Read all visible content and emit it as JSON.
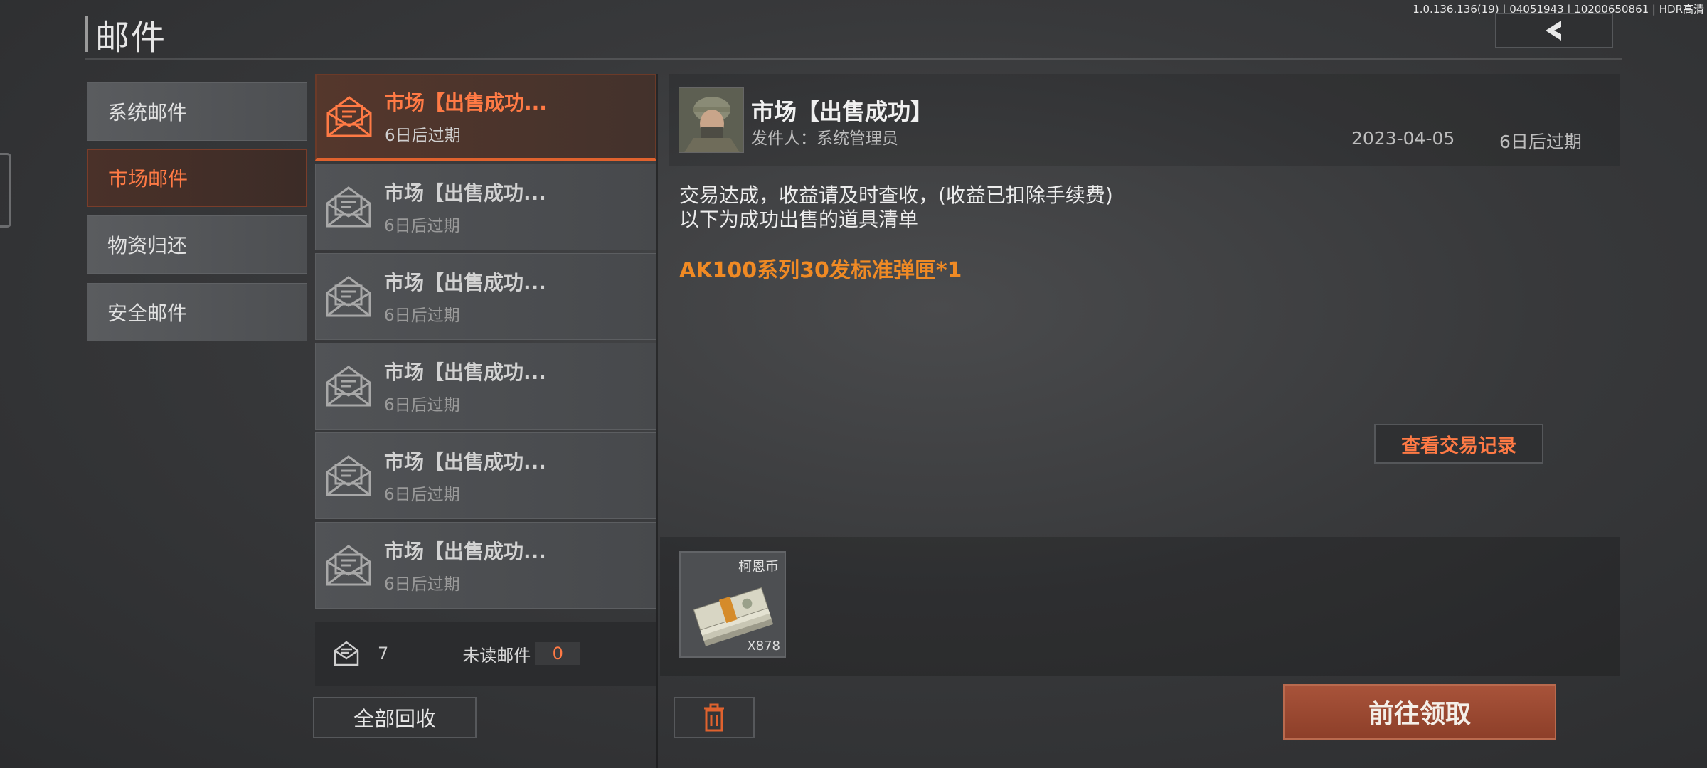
{
  "app": {
    "version": "1.0.136.136(19) | 04051943 | 10200650861 | HDR高清"
  },
  "header": {
    "title": "邮件"
  },
  "categories": [
    {
      "label": "系统邮件",
      "active": false
    },
    {
      "label": "市场邮件",
      "active": true
    },
    {
      "label": "物资归还",
      "active": false
    },
    {
      "label": "安全邮件",
      "active": false
    }
  ],
  "mails": [
    {
      "title": "市场【出售成功...",
      "expire": "6日后过期",
      "active": true
    },
    {
      "title": "市场【出售成功...",
      "expire": "6日后过期",
      "active": false
    },
    {
      "title": "市场【出售成功...",
      "expire": "6日后过期",
      "active": false
    },
    {
      "title": "市场【出售成功...",
      "expire": "6日后过期",
      "active": false
    },
    {
      "title": "市场【出售成功...",
      "expire": "6日后过期",
      "active": false
    },
    {
      "title": "市场【出售成功...",
      "expire": "6日后过期",
      "active": false
    }
  ],
  "list_footer": {
    "total": "7",
    "unread_label": "未读邮件",
    "unread_count": "0"
  },
  "buttons": {
    "collect_all": "全部回收",
    "view_records": "查看交易记录",
    "claim": "前往领取"
  },
  "detail": {
    "title": "市场【出售成功】",
    "sender": "发件人：系统管理员",
    "date": "2023-04-05",
    "expire": "6日后过期",
    "body_line1": "交易达成，收益请及时查收，(收益已扣除手续费)",
    "body_line2": "以下为成功出售的道具清单",
    "item_line": "AK100系列30发标准弹匣*1"
  },
  "attachment": {
    "name": "柯恩币",
    "quantity": "X878",
    "icon": "cash-bundle-icon"
  },
  "colors": {
    "accent": "#ff7a45",
    "highlight_text": "#f08a24",
    "claim_button": "#9a4a32"
  }
}
